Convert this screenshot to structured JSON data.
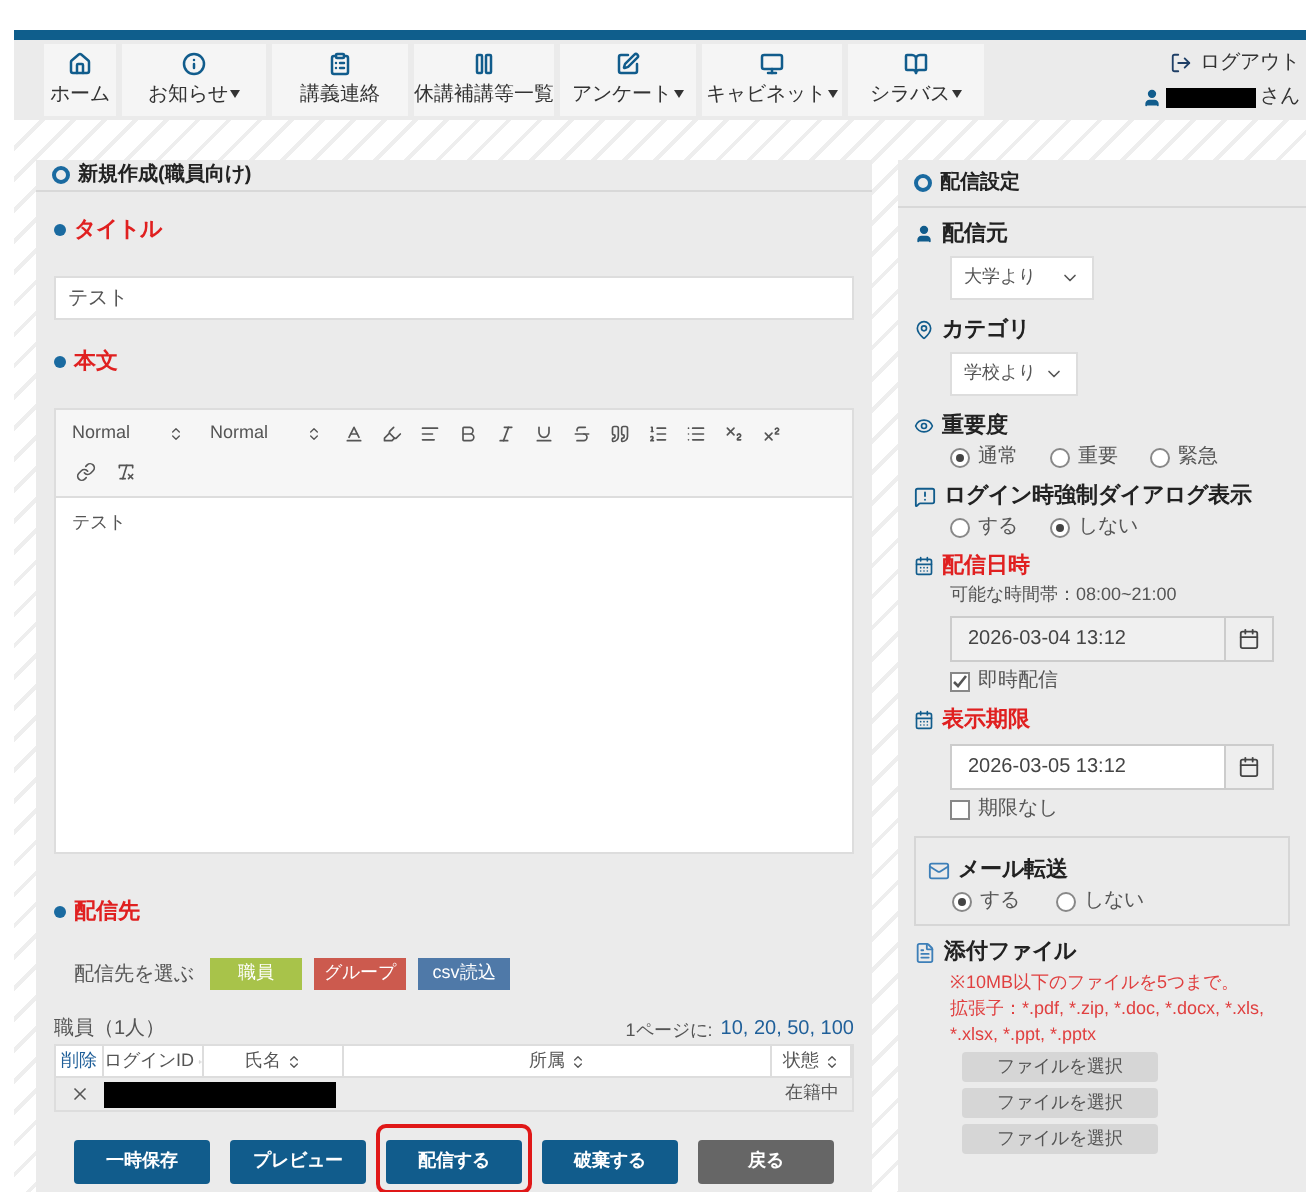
{
  "nav": {
    "items": [
      {
        "label": "ホーム",
        "dropdown": false
      },
      {
        "label": "お知らせ",
        "dropdown": true
      },
      {
        "label": "講義連絡",
        "dropdown": false
      },
      {
        "label": "休講補講等一覧",
        "dropdown": false
      },
      {
        "label": "アンケート",
        "dropdown": true
      },
      {
        "label": "キャビネット",
        "dropdown": true
      },
      {
        "label": "シラバス",
        "dropdown": true
      }
    ],
    "logout": "ログアウト",
    "user_suffix": "さん"
  },
  "form": {
    "title": "新規作成(職員向け)",
    "fields": [
      {
        "label": "タイトル",
        "required": true,
        "value": "テスト"
      }
    ],
    "body": {
      "label": "本文",
      "required": true,
      "font": "Normal",
      "size": "Normal",
      "content": "テスト"
    },
    "recipients": {
      "label": "配信先",
      "required": true,
      "choose_label": "配信先を選ぶ",
      "choose_buttons": [
        {
          "label": "職員",
          "color": "#a8c34a"
        },
        {
          "label": "グループ",
          "color": "#cc5a4e"
        },
        {
          "label": "csv読込",
          "color": "#4f79a8"
        }
      ],
      "count": "職員（1人）",
      "per_page_label": "1ページに:",
      "per_page_options": "10, 20, 50, 100",
      "columns": [
        {
          "label": "削除",
          "sortable": false
        },
        {
          "label": "ログインID",
          "sortable": true
        },
        {
          "label": "氏名",
          "sortable": true
        },
        {
          "label": "所属",
          "sortable": true
        },
        {
          "label": "状態",
          "sortable": true
        }
      ],
      "rows": [
        {
          "status": "在籍中"
        }
      ]
    },
    "actions": [
      {
        "label": "一時保存",
        "kind": "primary",
        "highlighted": false
      },
      {
        "label": "プレビュー",
        "kind": "primary",
        "highlighted": false
      },
      {
        "label": "配信する",
        "kind": "primary",
        "highlighted": true
      },
      {
        "label": "破棄する",
        "kind": "primary",
        "highlighted": false
      },
      {
        "label": "戻る",
        "kind": "secondary",
        "highlighted": false
      }
    ]
  },
  "settings": {
    "title": "配信設定",
    "sender": {
      "label": "配信元",
      "value": "大学より"
    },
    "category": {
      "label": "カテゴリ",
      "value": "学校より"
    },
    "importance": {
      "label": "重要度",
      "options": [
        {
          "label": "通常",
          "selected": true
        },
        {
          "label": "重要",
          "selected": false
        },
        {
          "label": "緊急",
          "selected": false
        }
      ]
    },
    "forced_dialog": {
      "label": "ログイン時強制ダイアログ表示",
      "options": [
        {
          "label": "する",
          "selected": false
        },
        {
          "label": "しない",
          "selected": true
        }
      ]
    },
    "delivery": {
      "label": "配信日時",
      "required": true,
      "hint": "可能な時間帯：08:00~21:00",
      "value": "2026-03-04 13:12",
      "disabled": true,
      "checkbox": {
        "label": "即時配信",
        "checked": true
      }
    },
    "expiry": {
      "label": "表示期限",
      "required": true,
      "value": "2026-03-05 13:12",
      "disabled": false,
      "checkbox": {
        "label": "期限なし",
        "checked": false
      }
    },
    "mail_forward": {
      "label": "メール転送",
      "options": [
        {
          "label": "する",
          "selected": true
        },
        {
          "label": "しない",
          "selected": false
        }
      ]
    },
    "attachments": {
      "label": "添付ファイル",
      "notes": [
        "※10MB以下のファイルを5つまで。",
        "拡張子：*.pdf, *.zip, *.doc, *.docx, *.xls, *.xlsx, *.ppt, *.pptx"
      ],
      "buttons": [
        "ファイルを選択",
        "ファイルを選択",
        "ファイルを選択"
      ]
    }
  }
}
